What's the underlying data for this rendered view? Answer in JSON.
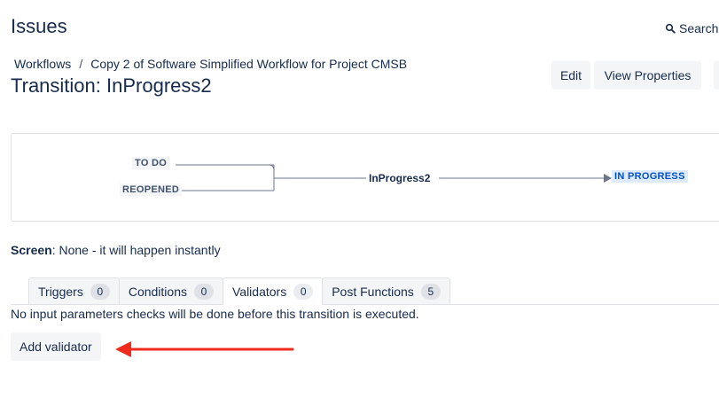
{
  "header": {
    "app_title": "Issues",
    "search_label": "Search",
    "search_icon": "search-icon"
  },
  "breadcrumb": {
    "items": [
      "Workflows",
      "Copy 2 of Software Simplified Workflow for Project CMSB"
    ],
    "separator": "/"
  },
  "page": {
    "title": "Transition: InProgress2"
  },
  "actions": {
    "edit_label": "Edit",
    "view_properties_label": "View Properties"
  },
  "diagram": {
    "from_statuses": [
      "TO DO",
      "REOPENED"
    ],
    "transition_name": "InProgress2",
    "to_status": "IN PROGRESS"
  },
  "screen": {
    "label": "Screen",
    "value": ": None - it will happen instantly"
  },
  "tabs": [
    {
      "label": "Triggers",
      "count": "0",
      "active": false
    },
    {
      "label": "Conditions",
      "count": "0",
      "active": false
    },
    {
      "label": "Validators",
      "count": "0",
      "active": true
    },
    {
      "label": "Post Functions",
      "count": "5",
      "active": false
    }
  ],
  "validators": {
    "description": "No input parameters checks will be done before this transition is executed.",
    "add_button_label": "Add validator"
  },
  "colors": {
    "annotation_arrow": "#ee2b1c",
    "text_primary": "#172b4d",
    "button_bg": "#f4f5f7"
  }
}
